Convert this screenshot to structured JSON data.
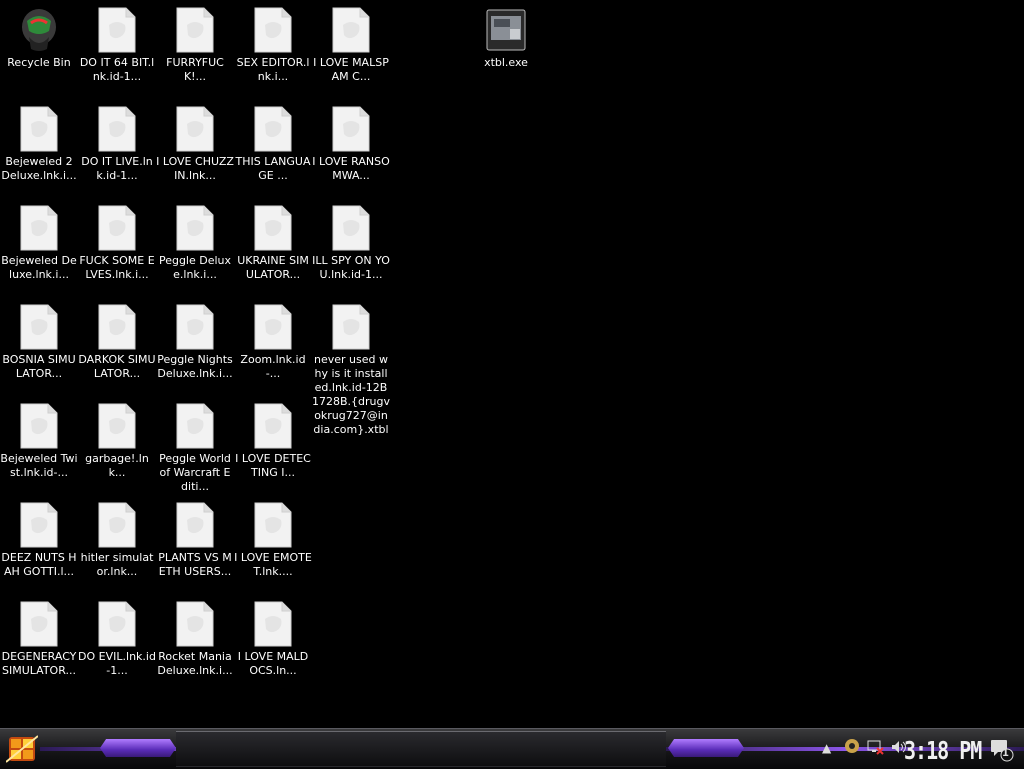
{
  "desktop": {
    "icons": [
      {
        "label": "Recycle Bin",
        "kind": "recycle-bin"
      },
      {
        "label": "DO IT 64 BIT.lnk.id-1...",
        "kind": "file"
      },
      {
        "label": "FURRYFUCK!...",
        "kind": "file"
      },
      {
        "label": "SEX EDITOR.lnk.i...",
        "kind": "file"
      },
      {
        "label": "I LOVE MALSPAM C...",
        "kind": "file"
      },
      {
        "label": "xtbl.exe",
        "kind": "exe"
      },
      {
        "label": "Bejeweled 2 Deluxe.lnk.i...",
        "kind": "file"
      },
      {
        "label": "DO IT LIVE.lnk.id-1...",
        "kind": "file"
      },
      {
        "label": "I LOVE CHUZZIN.lnk...",
        "kind": "file"
      },
      {
        "label": "THIS LANGUAGE ...",
        "kind": "file"
      },
      {
        "label": "I LOVE RANSOMWA...",
        "kind": "file"
      },
      {
        "label": "Bejeweled Deluxe.lnk.i...",
        "kind": "file"
      },
      {
        "label": "FUCK SOME ELVES.lnk.i...",
        "kind": "file"
      },
      {
        "label": "Peggle Deluxe.lnk.i...",
        "kind": "file"
      },
      {
        "label": "UKRAINE SIMULATOR...",
        "kind": "file"
      },
      {
        "label": "ILL SPY ON YOU.lnk.id-1...",
        "kind": "file"
      },
      {
        "label": "BOSNIA SIMULATOR...",
        "kind": "file"
      },
      {
        "label": "DARKOK SIMULATOR...",
        "kind": "file"
      },
      {
        "label": "Peggle Nights Deluxe.lnk.i...",
        "kind": "file"
      },
      {
        "label": "Zoom.lnk.id-...",
        "kind": "file"
      },
      {
        "label": "never used why is it installed.lnk.id-12B1728B.{drugvokrug727@india.com}.xtbl",
        "kind": "file"
      },
      {
        "label": "Bejeweled Twist.lnk.id-...",
        "kind": "file"
      },
      {
        "label": "garbage!.lnk...",
        "kind": "file"
      },
      {
        "label": "Peggle World of Warcraft Editi...",
        "kind": "file"
      },
      {
        "label": "I LOVE DETECTING I...",
        "kind": "file"
      },
      {
        "label": "DEEZ NUTS HAH GOTTI.l...",
        "kind": "file"
      },
      {
        "label": "hitler simulator.lnk...",
        "kind": "file"
      },
      {
        "label": "PLANTS VS METH USERS...",
        "kind": "file"
      },
      {
        "label": "I LOVE EMOTET.lnk....",
        "kind": "file"
      },
      {
        "label": "DEGENERACY SIMULATOR...",
        "kind": "file"
      },
      {
        "label": "DO EVIL.lnk.id-1...",
        "kind": "file"
      },
      {
        "label": "Rocket Mania Deluxe.lnk.i...",
        "kind": "file"
      },
      {
        "label": "I LOVE MALDOCS.ln...",
        "kind": "file"
      }
    ]
  },
  "taskbar": {
    "clock": "3:18 PM",
    "notification_count": "1",
    "accent_color": "#8c56e8",
    "tray_icons": [
      "show-hidden-icons-chevron",
      "media-player-icon",
      "network-disconnected-icon",
      "volume-icon",
      "action-center-icon"
    ]
  }
}
